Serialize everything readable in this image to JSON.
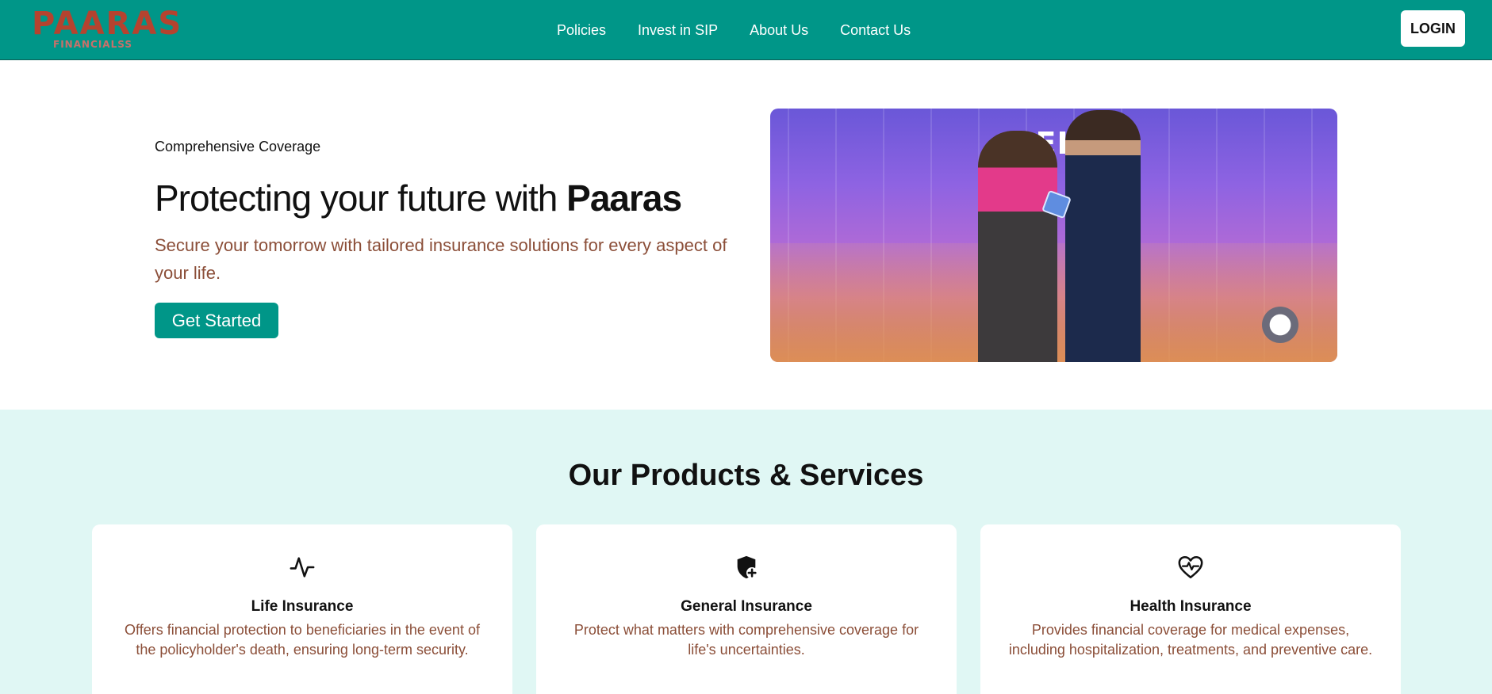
{
  "header": {
    "logo_text": "PAARAS",
    "logo_subtext": "FINANCIALSS",
    "nav": [
      {
        "label": "Policies"
      },
      {
        "label": "Invest in SIP"
      },
      {
        "label": "About Us"
      },
      {
        "label": "Contact Us"
      }
    ],
    "login_label": "LOGIN",
    "colors": {
      "bar": "#009688",
      "logo": "#b5432f"
    }
  },
  "hero": {
    "eyebrow": "Comprehensive Coverage",
    "title_prefix": "Protecting your future with ",
    "title_brand": "Paaras",
    "description": "Secure your tomorrow with tailored insurance solutions for every aspect of your life.",
    "cta_label": "Get Started",
    "image_sign_text": "DELH"
  },
  "products": {
    "title": "Our Products & Services",
    "items": [
      {
        "icon": "activity-icon",
        "title": "Life Insurance",
        "description": "Offers financial protection to beneficiaries in the event of the policyholder's death, ensuring long-term security."
      },
      {
        "icon": "shield-plus-icon",
        "title": "General Insurance",
        "description": "Protect what matters with comprehensive coverage for life's uncertainties."
      },
      {
        "icon": "heart-pulse-icon",
        "title": "Health Insurance",
        "description": "Provides financial coverage for medical expenses, including hospitalization, treatments, and preventive care."
      }
    ]
  }
}
